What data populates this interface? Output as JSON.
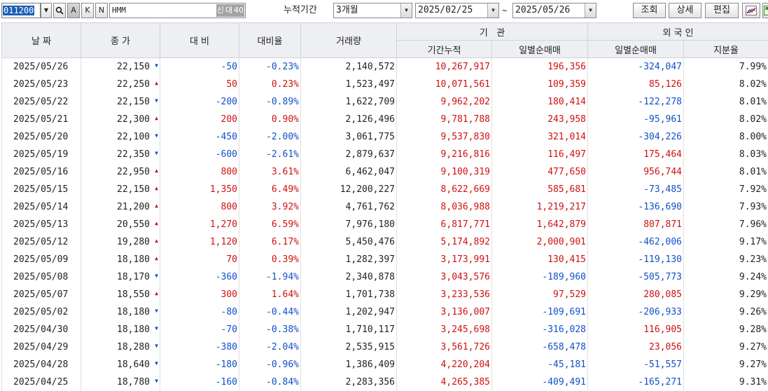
{
  "toolbar": {
    "stock_code": "011200",
    "buttons": [
      "A",
      "K",
      "N"
    ],
    "stock_name": "HMM",
    "tags": [
      "신",
      "대",
      "40"
    ],
    "period_label": "누적기간",
    "period_select": "3개월",
    "start_date": "2025/02/25",
    "tilde": "~",
    "end_date": "2025/05/26",
    "query_label": "조회",
    "detail_label": "상세",
    "edit_label": "편집"
  },
  "table": {
    "headers": {
      "date": "날 짜",
      "close": "종 가",
      "change": "대 비",
      "change_rate": "대비율",
      "volume": "거래량",
      "institution": "기   관",
      "inst_cum": "기간누적",
      "inst_daily": "일별순매매",
      "foreign": "외 국 인",
      "foreign_daily": "일별순매매",
      "foreign_share": "지분율"
    },
    "rows": [
      {
        "date": "2025/05/26",
        "close": "22,150",
        "dir": "dn",
        "change": "-50",
        "rate": "-0.23%",
        "volume": "2,140,572",
        "inst_cum": "10,267,917",
        "inst_daily": "196,356",
        "frgn_daily": "-324,047",
        "share": "7.99%"
      },
      {
        "date": "2025/05/23",
        "close": "22,250",
        "dir": "up",
        "change": "50",
        "rate": "0.23%",
        "volume": "1,523,497",
        "inst_cum": "10,071,561",
        "inst_daily": "109,359",
        "frgn_daily": "85,126",
        "share": "8.02%"
      },
      {
        "date": "2025/05/22",
        "close": "22,150",
        "dir": "dn",
        "change": "-200",
        "rate": "-0.89%",
        "volume": "1,622,709",
        "inst_cum": "9,962,202",
        "inst_daily": "180,414",
        "frgn_daily": "-122,278",
        "share": "8.01%"
      },
      {
        "date": "2025/05/21",
        "close": "22,300",
        "dir": "up",
        "change": "200",
        "rate": "0.90%",
        "volume": "2,126,496",
        "inst_cum": "9,781,788",
        "inst_daily": "243,958",
        "frgn_daily": "-95,961",
        "share": "8.02%"
      },
      {
        "date": "2025/05/20",
        "close": "22,100",
        "dir": "dn",
        "change": "-450",
        "rate": "-2.00%",
        "volume": "3,061,775",
        "inst_cum": "9,537,830",
        "inst_daily": "321,014",
        "frgn_daily": "-304,226",
        "share": "8.00%"
      },
      {
        "date": "2025/05/19",
        "close": "22,350",
        "dir": "dn",
        "change": "-600",
        "rate": "-2.61%",
        "volume": "2,879,637",
        "inst_cum": "9,216,816",
        "inst_daily": "116,497",
        "frgn_daily": "175,464",
        "share": "8.03%"
      },
      {
        "date": "2025/05/16",
        "close": "22,950",
        "dir": "up",
        "change": "800",
        "rate": "3.61%",
        "volume": "6,462,047",
        "inst_cum": "9,100,319",
        "inst_daily": "477,650",
        "frgn_daily": "956,744",
        "share": "8.01%"
      },
      {
        "date": "2025/05/15",
        "close": "22,150",
        "dir": "up",
        "change": "1,350",
        "rate": "6.49%",
        "volume": "12,200,227",
        "inst_cum": "8,622,669",
        "inst_daily": "585,681",
        "frgn_daily": "-73,485",
        "share": "7.92%"
      },
      {
        "date": "2025/05/14",
        "close": "21,200",
        "dir": "up",
        "change": "800",
        "rate": "3.92%",
        "volume": "4,761,762",
        "inst_cum": "8,036,988",
        "inst_daily": "1,219,217",
        "frgn_daily": "-136,690",
        "share": "7.93%"
      },
      {
        "date": "2025/05/13",
        "close": "20,550",
        "dir": "up",
        "change": "1,270",
        "rate": "6.59%",
        "volume": "7,976,180",
        "inst_cum": "6,817,771",
        "inst_daily": "1,642,879",
        "frgn_daily": "807,871",
        "share": "7.96%"
      },
      {
        "date": "2025/05/12",
        "close": "19,280",
        "dir": "up",
        "change": "1,120",
        "rate": "6.17%",
        "volume": "5,450,476",
        "inst_cum": "5,174,892",
        "inst_daily": "2,000,901",
        "frgn_daily": "-462,006",
        "share": "9.17%"
      },
      {
        "date": "2025/05/09",
        "close": "18,180",
        "dir": "up",
        "change": "70",
        "rate": "0.39%",
        "volume": "1,282,397",
        "inst_cum": "3,173,991",
        "inst_daily": "130,415",
        "frgn_daily": "-119,130",
        "share": "9.23%"
      },
      {
        "date": "2025/05/08",
        "close": "18,170",
        "dir": "dn",
        "change": "-360",
        "rate": "-1.94%",
        "volume": "2,340,878",
        "inst_cum": "3,043,576",
        "inst_daily": "-189,960",
        "frgn_daily": "-505,773",
        "share": "9.24%"
      },
      {
        "date": "2025/05/07",
        "close": "18,550",
        "dir": "up",
        "change": "300",
        "rate": "1.64%",
        "volume": "1,701,738",
        "inst_cum": "3,233,536",
        "inst_daily": "97,529",
        "frgn_daily": "280,085",
        "share": "9.29%"
      },
      {
        "date": "2025/05/02",
        "close": "18,180",
        "dir": "dn",
        "change": "-80",
        "rate": "-0.44%",
        "volume": "1,202,947",
        "inst_cum": "3,136,007",
        "inst_daily": "-109,691",
        "frgn_daily": "-206,933",
        "share": "9.26%"
      },
      {
        "date": "2025/04/30",
        "close": "18,180",
        "dir": "dn",
        "change": "-70",
        "rate": "-0.38%",
        "volume": "1,710,117",
        "inst_cum": "3,245,698",
        "inst_daily": "-316,028",
        "frgn_daily": "116,905",
        "share": "9.28%"
      },
      {
        "date": "2025/04/29",
        "close": "18,280",
        "dir": "dn",
        "change": "-380",
        "rate": "-2.04%",
        "volume": "2,535,915",
        "inst_cum": "3,561,726",
        "inst_daily": "-658,478",
        "frgn_daily": "23,056",
        "share": "9.27%"
      },
      {
        "date": "2025/04/28",
        "close": "18,640",
        "dir": "dn",
        "change": "-180",
        "rate": "-0.96%",
        "volume": "1,386,409",
        "inst_cum": "4,220,204",
        "inst_daily": "-45,181",
        "frgn_daily": "-51,557",
        "share": "9.27%"
      },
      {
        "date": "2025/04/25",
        "close": "18,780",
        "dir": "dn",
        "change": "-160",
        "rate": "-0.84%",
        "volume": "2,283,356",
        "inst_cum": "4,265,385",
        "inst_daily": "-409,491",
        "frgn_daily": "-165,271",
        "share": "9.31%"
      }
    ]
  },
  "colors": {
    "up": "#d01010",
    "down": "#1050c8",
    "header_bg": "#eeeff3",
    "selection": "#1a5fb4"
  },
  "icons": {
    "search": "search-icon",
    "chart": "chart-icon",
    "save": "save-icon",
    "up_arrow": "up-triangle-icon",
    "down_arrow": "down-triangle-icon"
  }
}
